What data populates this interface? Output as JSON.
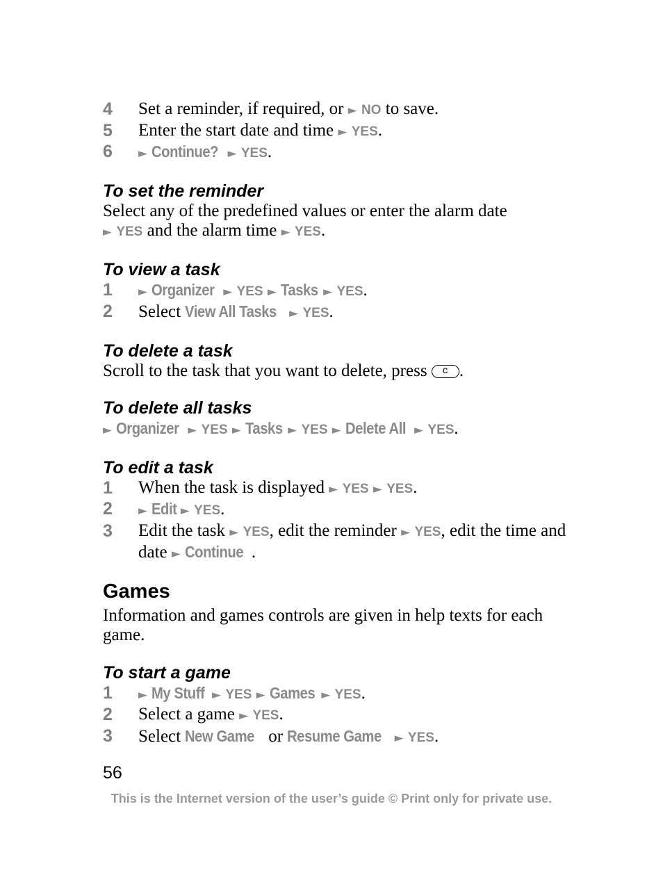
{
  "steps_top": [
    {
      "n": "4",
      "a": "Set a reminder, if required, or ",
      "b": "NO",
      "c": " to save."
    },
    {
      "n": "5",
      "a": "Enter the start date and time ",
      "b": "YES",
      "c": "."
    },
    {
      "n": "6",
      "cont": "Continue?",
      "b": "YES",
      "c": "."
    }
  ],
  "reminder": {
    "title": "To set the reminder",
    "t1": "Select any of the predefined values or enter the alarm date",
    "yes": "YES",
    "t2": " and the alarm time ",
    "t3": "."
  },
  "view": {
    "title": "To view a task",
    "organizer": "Organizer",
    "yes": "YES",
    "tasks": "Tasks",
    "s2a": "Select ",
    "viewall": "View All Tasks",
    "n1": "1",
    "n2": "2"
  },
  "delete": {
    "title": "To delete a task",
    "text": "Scroll to the task that you want to delete, press ",
    "key": "c"
  },
  "deleteall": {
    "title": "To delete all tasks",
    "organizer": "Organizer",
    "yes": "YES",
    "tasks": "Tasks",
    "deleteall": "Delete All"
  },
  "edit": {
    "title": "To edit a task",
    "s1": "When the task is displayed ",
    "yes": "YES",
    "edit": "Edit",
    "s3a": "Edit the task ",
    "s3b": ", edit the reminder ",
    "s3c": ", edit the time and date ",
    "cont": "Continue",
    "n1": "1",
    "n2": "2",
    "n3": "3"
  },
  "games": {
    "heading": "Games",
    "text": "Information and games controls are given in help texts for each game.",
    "title": "To start a game",
    "mystuff": "My Stuff",
    "yes": "YES",
    "games": "Games",
    "s2": "Select a game ",
    "s3a": "Select ",
    "newgame": "New Game",
    "or": " or ",
    "resume": "Resume Game",
    "n1": "1",
    "n2": "2",
    "n3": "3"
  },
  "page_number": "56",
  "footer": "This is the Internet version of the user’s guide © Print only for private use.",
  "arrow": "►",
  "dot": "."
}
